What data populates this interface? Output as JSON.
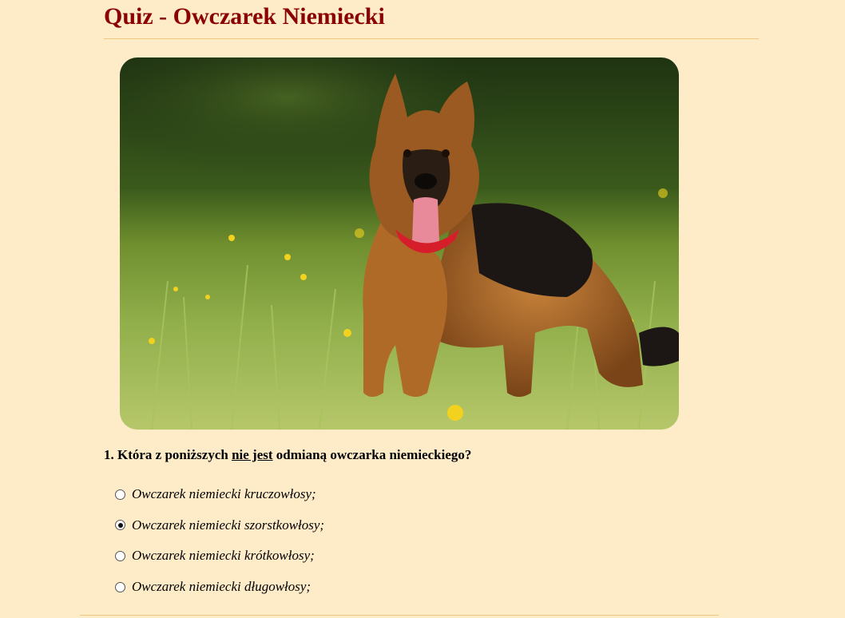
{
  "page": {
    "title": "Quiz - Owczarek Niemiecki"
  },
  "question": {
    "number": "1.",
    "text_before": "Która z poniższych",
    "text_emphasis": "nie jest",
    "text_after": "odmianą owczarka niemieckiego?"
  },
  "answers": [
    {
      "label": "Owczarek niemiecki kruczowłosy;",
      "selected": false
    },
    {
      "label": "Owczarek niemiecki szorstkowłosy;",
      "selected": true
    },
    {
      "label": "Owczarek niemiecki krótkowłosy;",
      "selected": false
    },
    {
      "label": "Owczarek niemiecki długowłosy;",
      "selected": false
    }
  ],
  "colors": {
    "background": "#feecc9",
    "title": "#8b0000",
    "rule": "#f2c87c"
  },
  "icons": {
    "photo": "german-shepherd-dog-photo"
  }
}
